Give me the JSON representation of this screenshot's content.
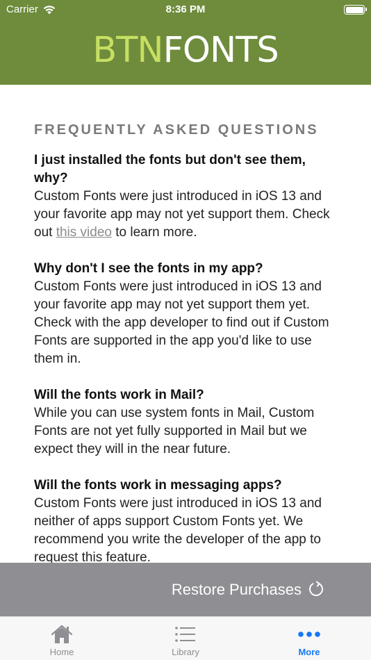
{
  "status_bar": {
    "carrier": "Carrier",
    "time": "8:36 PM"
  },
  "header": {
    "logo_part1": "BTN",
    "logo_part2": "FONTS",
    "background_color": "#6e8c3c",
    "logo_accent_color": "#c7df62"
  },
  "faq": {
    "heading": "FREQUENTLY ASKED QUESTIONS",
    "items": [
      {
        "question": "I just installed the fonts but don't see them, why?",
        "answer_before_link": "Custom Fonts were just introduced in iOS 13 and your favorite app may not yet support them. Check out ",
        "link_text": "this video",
        "answer_after_link": " to learn more."
      },
      {
        "question": "Why don't I see the fonts in my app?",
        "answer": "Custom Fonts were just introduced in iOS 13 and your favorite app may not yet support them yet. Check with the app developer to find out if Custom Fonts are supported in the app you'd like to use them in."
      },
      {
        "question": "Will the fonts work in Mail?",
        "answer": "While you can use system fonts in Mail, Custom Fonts are not yet fully supported in Mail but we expect they will in the near future."
      },
      {
        "question": "Will the fonts work in messaging apps?",
        "answer": "Custom Fonts were just introduced in iOS 13 and neither of apps support Custom Fonts yet. We recommend you write the developer of the app to request this feature."
      }
    ]
  },
  "restore": {
    "label": "Restore Purchases",
    "icon": "refresh-icon"
  },
  "tab_bar": {
    "tabs": [
      {
        "label": "Home",
        "icon": "home-icon",
        "active": false
      },
      {
        "label": "Library",
        "icon": "list-icon",
        "active": false
      },
      {
        "label": "More",
        "icon": "more-dots-icon",
        "active": true
      }
    ],
    "active_color": "#1478f5",
    "inactive_color": "#8e8e93"
  }
}
